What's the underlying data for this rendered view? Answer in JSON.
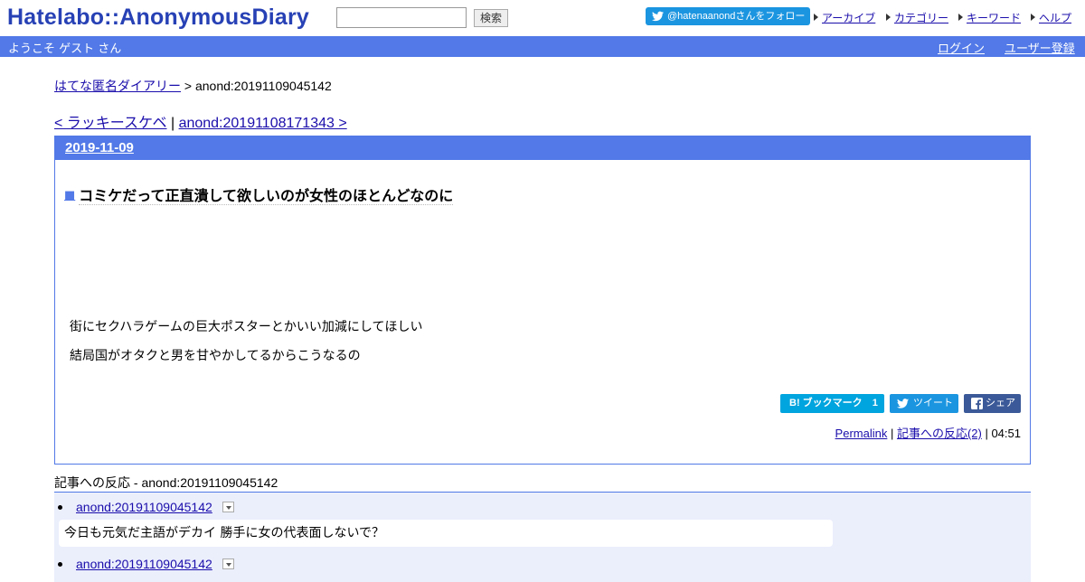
{
  "header": {
    "logo_text": "Hatelabo::AnonymousDiary",
    "search": {
      "value": "",
      "button_label": "検索"
    },
    "follow_button": "@hatenaanondさんをフォロー",
    "links": [
      "アーカイブ",
      "カテゴリー",
      "キーワード",
      "ヘルプ"
    ]
  },
  "userbar": {
    "welcome": "ようこそ ゲスト さん",
    "login": "ログイン",
    "register": "ユーザー登録"
  },
  "breadcrumb": {
    "home": "はてな匿名ダイアリー",
    "separator": " > ",
    "current": "anond:20191109045142"
  },
  "pager": {
    "prev": "< ラッキースケベ",
    "divider": " | ",
    "next": "anond:20191108171343 >"
  },
  "entry": {
    "date": "2019-11-09",
    "title_marker": "■",
    "title": "コミケだって正直潰して欲しいのが女性のほとんどなのに",
    "body": [
      "街にセクハラゲームの巨大ポスターとかいい加減にしてほしい",
      "結局国がオタクと男を甘やかしてるからこうなるの"
    ],
    "share": {
      "bookmark_label": "B! ブックマーク",
      "bookmark_count": "1",
      "tweet_label": "ツイート",
      "facebook_label": "シェア"
    },
    "footer": {
      "permalink": "Permalink",
      "sep1": " | ",
      "reactions_link": "記事への反応(2)",
      "sep2": " | ",
      "time": "04:51"
    }
  },
  "reactions": {
    "heading": "記事への反応 - anond:20191109045142",
    "items": [
      {
        "id": "anond:20191109045142",
        "quote": "今日も元気だ主語がデカイ 勝手に女の代表面しないで？"
      },
      {
        "id": "anond:20191109045142",
        "quote": ""
      }
    ]
  },
  "colors": {
    "brand_blue": "#5279e7",
    "logo_blue": "#2741b5",
    "twitter": "#1b95e0",
    "hatena_bookmark": "#00a4de",
    "facebook": "#3b5998"
  }
}
